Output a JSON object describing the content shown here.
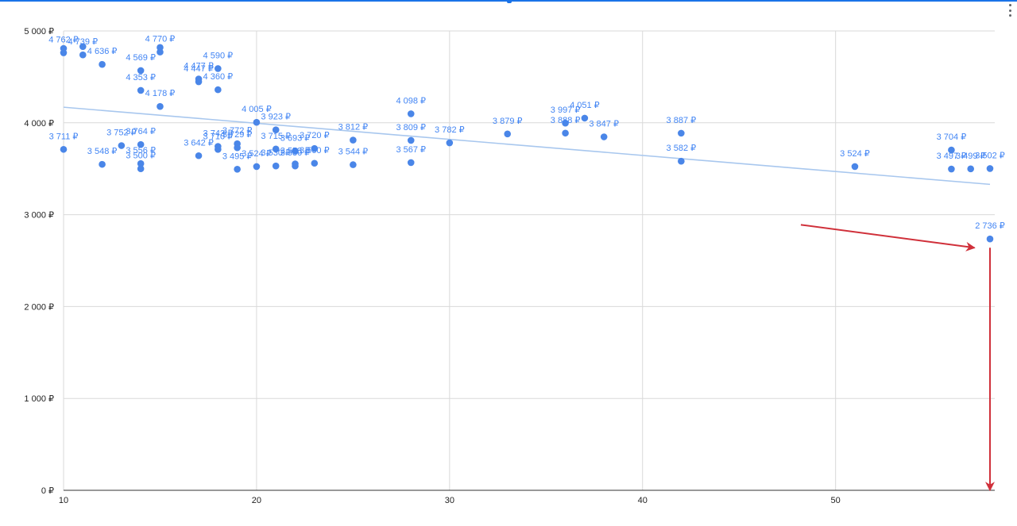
{
  "chart_data": {
    "type": "scatter",
    "title": "",
    "xlabel": "",
    "ylabel": "",
    "xlim": [
      10,
      58
    ],
    "ylim": [
      0,
      5000
    ],
    "x_ticks": [
      "10",
      "20",
      "30",
      "40",
      "50"
    ],
    "y_ticks": [
      "0 ₽",
      "1 000 ₽",
      "2 000 ₽",
      "3 000 ₽",
      "4 000 ₽",
      "5 000 ₽"
    ],
    "grid": true,
    "legend": "none",
    "colors": {
      "points": "#4a86e8",
      "labels": "#4285f4",
      "trendline": "#a8c7ee",
      "annotation": "#d0303a",
      "grid": "#d9d9d9"
    },
    "trendline": {
      "type": "linear",
      "x": [
        10,
        58
      ],
      "y": [
        4170,
        3330
      ]
    },
    "points": [
      {
        "x": 10,
        "y": 4762,
        "label": "4 762 ₽"
      },
      {
        "x": 10,
        "y": 4810,
        "label": ""
      },
      {
        "x": 10,
        "y": 3711,
        "label": "3 711 ₽"
      },
      {
        "x": 11,
        "y": 4739,
        "label": "4 739 ₽"
      },
      {
        "x": 11,
        "y": 4830,
        "label": ""
      },
      {
        "x": 12,
        "y": 4636,
        "label": "4 636 ₽"
      },
      {
        "x": 12,
        "y": 3548,
        "label": "3 548 ₽"
      },
      {
        "x": 13,
        "y": 3752,
        "label": "3 752 ₽"
      },
      {
        "x": 14,
        "y": 4569,
        "label": "4 569 ₽"
      },
      {
        "x": 14,
        "y": 4353,
        "label": "4 353 ₽"
      },
      {
        "x": 14,
        "y": 3764,
        "label": "3 764 ₽"
      },
      {
        "x": 14,
        "y": 3556,
        "label": "3 556 ₽"
      },
      {
        "x": 14,
        "y": 3500,
        "label": "3 500 ₽"
      },
      {
        "x": 15,
        "y": 4770,
        "label": "4 770 ₽"
      },
      {
        "x": 15,
        "y": 4820,
        "label": ""
      },
      {
        "x": 15,
        "y": 4178,
        "label": "4 178 ₽"
      },
      {
        "x": 17,
        "y": 4477,
        "label": "4 477 ₽"
      },
      {
        "x": 17,
        "y": 4447,
        "label": "4 447 ₽"
      },
      {
        "x": 17,
        "y": 3642,
        "label": "3 642 ₽"
      },
      {
        "x": 18,
        "y": 4590,
        "label": "4 590 ₽"
      },
      {
        "x": 18,
        "y": 4360,
        "label": "4 360 ₽"
      },
      {
        "x": 18,
        "y": 3743,
        "label": "3 743 ₽"
      },
      {
        "x": 18,
        "y": 3710,
        "label": "3 710 ₽"
      },
      {
        "x": 19,
        "y": 3772,
        "label": "3 772 ₽"
      },
      {
        "x": 19,
        "y": 3729,
        "label": "3 729 ₽"
      },
      {
        "x": 19,
        "y": 3495,
        "label": "3 495 ₽"
      },
      {
        "x": 20,
        "y": 4005,
        "label": "4 005 ₽"
      },
      {
        "x": 20,
        "y": 3524,
        "label": "3 524 ₽"
      },
      {
        "x": 21,
        "y": 3923,
        "label": "3 923 ₽"
      },
      {
        "x": 21,
        "y": 3715,
        "label": "3 715 ₽"
      },
      {
        "x": 21,
        "y": 3530,
        "label": "3 530 ₽"
      },
      {
        "x": 22,
        "y": 3693,
        "label": "3 693 ₽"
      },
      {
        "x": 22,
        "y": 3553,
        "label": "3 553 ₽"
      },
      {
        "x": 22,
        "y": 3530,
        "label": "3 530 ₽"
      },
      {
        "x": 23,
        "y": 3720,
        "label": "3 720 ₽"
      },
      {
        "x": 23,
        "y": 3560,
        "label": "3 560 ₽"
      },
      {
        "x": 25,
        "y": 3812,
        "label": "3 812 ₽"
      },
      {
        "x": 25,
        "y": 3544,
        "label": "3 544 ₽"
      },
      {
        "x": 28,
        "y": 4098,
        "label": "4 098 ₽"
      },
      {
        "x": 28,
        "y": 3809,
        "label": "3 809 ₽"
      },
      {
        "x": 28,
        "y": 3567,
        "label": "3 567 ₽"
      },
      {
        "x": 30,
        "y": 3782,
        "label": "3 782 ₽"
      },
      {
        "x": 33,
        "y": 3879,
        "label": "3 879 ₽"
      },
      {
        "x": 36,
        "y": 3997,
        "label": "3 997 ₽"
      },
      {
        "x": 36,
        "y": 3888,
        "label": "3 888 ₽"
      },
      {
        "x": 37,
        "y": 4051,
        "label": "4 051 ₽"
      },
      {
        "x": 38,
        "y": 3847,
        "label": "3 847 ₽"
      },
      {
        "x": 42,
        "y": 3887,
        "label": "3 887 ₽"
      },
      {
        "x": 42,
        "y": 3582,
        "label": "3 582 ₽"
      },
      {
        "x": 51,
        "y": 3524,
        "label": "3 524 ₽"
      },
      {
        "x": 56,
        "y": 3704,
        "label": "3 704 ₽"
      },
      {
        "x": 56,
        "y": 3497,
        "label": "3 497 ₽"
      },
      {
        "x": 57,
        "y": 3499,
        "label": "3 499 ₽"
      },
      {
        "x": 58,
        "y": 3502,
        "label": "3 502 ₽"
      },
      {
        "x": 58,
        "y": 2736,
        "label": "2 736 ₽"
      }
    ],
    "annotations": [
      {
        "type": "arrow",
        "from": [
          48.2,
          2890
        ],
        "to": [
          57.2,
          2640
        ]
      },
      {
        "type": "arrow",
        "from": [
          58,
          2640
        ],
        "to": [
          58,
          0
        ]
      }
    ]
  }
}
